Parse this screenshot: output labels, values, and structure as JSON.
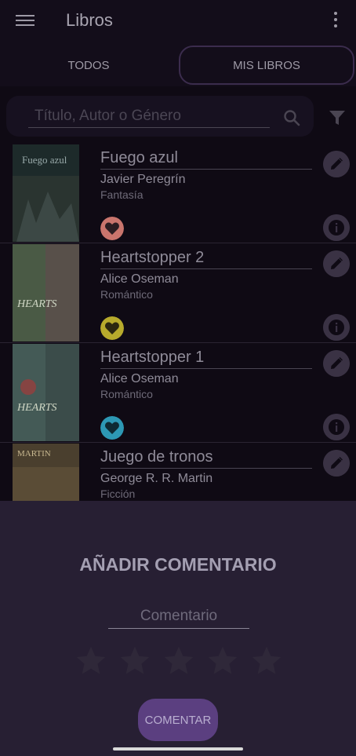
{
  "app_bar": {
    "title": "Libros"
  },
  "tabs": [
    {
      "label": "TODOS"
    },
    {
      "label": "MIS LIBROS"
    }
  ],
  "search": {
    "placeholder": "Título, Autor o Género",
    "value": ""
  },
  "books": [
    {
      "title": "Fuego azul",
      "author": "Javier Peregrín",
      "genre": "Fantasía",
      "heart_color": "#c9756d"
    },
    {
      "title": "Heartstopper 2",
      "author": "Alice Oseman",
      "genre": "Romántico",
      "heart_color": "#b7aa2c"
    },
    {
      "title": "Heartstopper 1",
      "author": "Alice Oseman",
      "genre": "Romántico",
      "heart_color": "#2d98b4"
    },
    {
      "title": "Juego de tronos",
      "author": "George R. R. Martin",
      "genre": "Ficción",
      "heart_color": "#888888"
    }
  ],
  "sheet": {
    "title": "AÑADIR COMENTARIO",
    "comment_placeholder": "Comentario",
    "rating": 0,
    "stars_count": 5,
    "button_label": "COMENTAR"
  },
  "colors": {
    "accent": "#5b3f80",
    "background": "#0f0a14",
    "sheet": "#271f33"
  },
  "icons": [
    "menu-icon",
    "more-vert-icon",
    "search-icon",
    "filter-icon",
    "edit-icon",
    "info-icon",
    "heart-icon",
    "star-icon"
  ]
}
